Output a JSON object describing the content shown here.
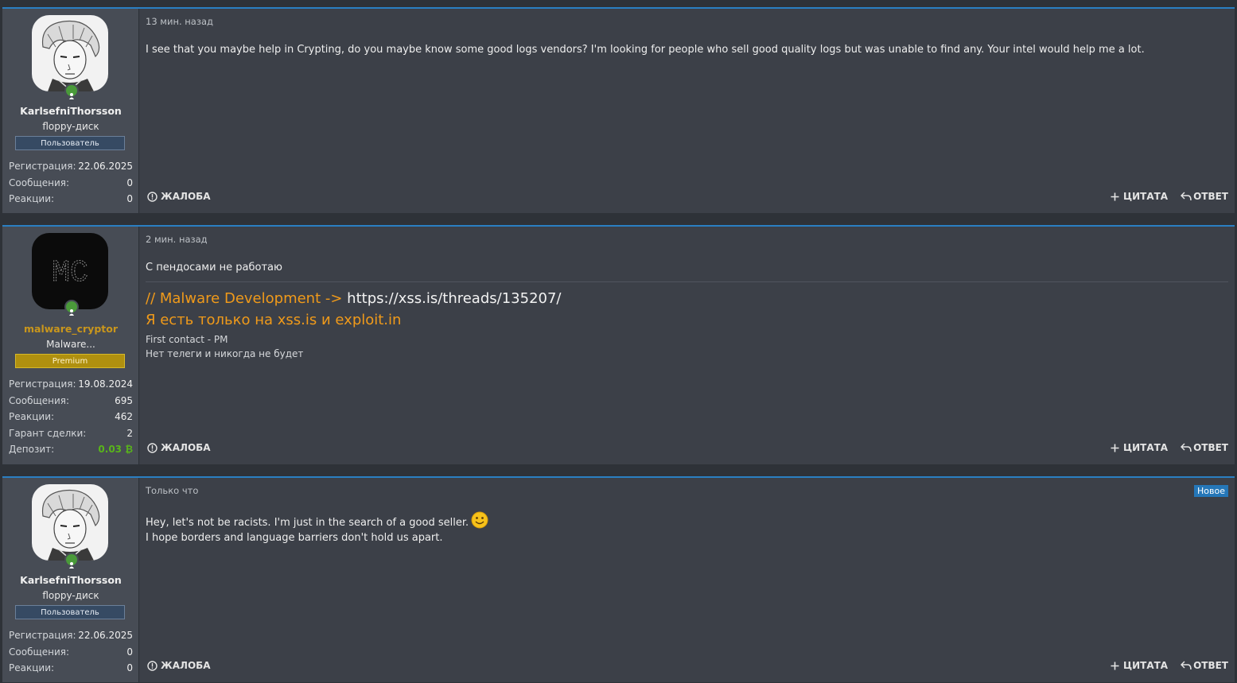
{
  "posts": [
    {
      "username": "KarlsefniThorsson",
      "user_title": "floppy-диск",
      "role": "Пользователь",
      "stats": [
        {
          "label": "Регистрация:",
          "value": "22.06.2025"
        },
        {
          "label": "Сообщения:",
          "value": "0"
        },
        {
          "label": "Реакции:",
          "value": "0"
        }
      ],
      "timestamp": "13 мин. назад",
      "message": "I see that you maybe help in Crypting, do you maybe know some good logs vendors? I'm looking for people who sell good quality logs but was unable to find any. Your intel would help me a lot."
    },
    {
      "username": "malware_cryptor",
      "user_title": "Malware...",
      "role": "Premium",
      "avatar_text": "MC",
      "stats": [
        {
          "label": "Регистрация:",
          "value": "19.08.2024"
        },
        {
          "label": "Сообщения:",
          "value": "695"
        },
        {
          "label": "Реакции:",
          "value": "462"
        },
        {
          "label": "Гарант сделки:",
          "value": "2"
        },
        {
          "label": "Депозит:",
          "value": "0.03 ₿"
        }
      ],
      "timestamp": "2 мин. назад",
      "message": "С пендосами не работаю",
      "signature": {
        "line1_prefix": "// Malware Development -> ",
        "line1_link": "https://xss.is/threads/135207/",
        "line2": "Я есть только на xss.is и exploit.in",
        "line3": "First contact - PM",
        "line4": "Нет телеги и никогда не будет"
      }
    },
    {
      "username": "KarlsefniThorsson",
      "user_title": "floppy-диск",
      "role": "Пользователь",
      "stats": [
        {
          "label": "Регистрация:",
          "value": "22.06.2025"
        },
        {
          "label": "Сообщения:",
          "value": "0"
        },
        {
          "label": "Реакции:",
          "value": "0"
        }
      ],
      "timestamp": "Только что",
      "new_badge": "Новое",
      "message_line1": "Hey, let's not be racists. I'm just in the search of a good seller.",
      "message_line2": "I hope borders and language barriers don't hold us apart."
    }
  ],
  "actions": {
    "report": "ЖАЛОБА",
    "quote": "ЦИТАТА",
    "reply": "ОТВЕТ"
  },
  "colors": {
    "accent": "#2a7fc2",
    "premium": "#b0900f",
    "signature_orange": "#f09a1a",
    "deposit_green": "#59b51a"
  }
}
